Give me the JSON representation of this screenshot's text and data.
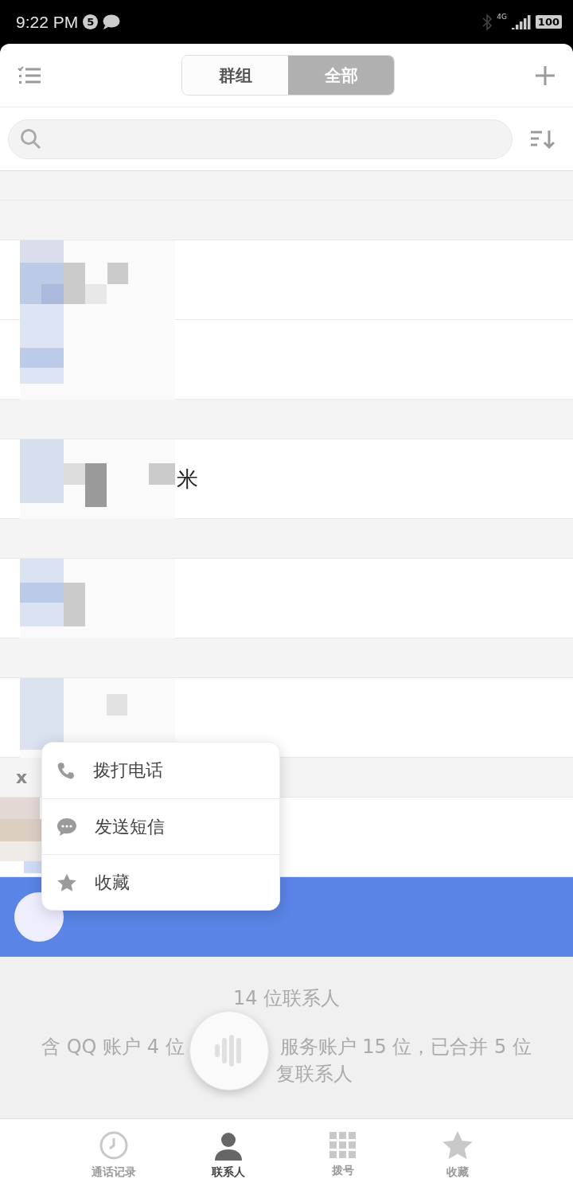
{
  "status_bar": {
    "time": "9:22 PM",
    "notification_count": "5",
    "network": "4G",
    "battery": "100"
  },
  "segments": [
    {
      "label": "群组",
      "selected": false
    },
    {
      "label": "全部",
      "selected": true
    }
  ],
  "list": [
    {
      "kind": "partial_header"
    },
    {
      "kind": "header"
    },
    {
      "kind": "contact"
    },
    {
      "kind": "contact"
    },
    {
      "kind": "header"
    },
    {
      "kind": "contact",
      "name": "米"
    },
    {
      "kind": "header"
    },
    {
      "kind": "contact"
    },
    {
      "kind": "header"
    },
    {
      "kind": "contact"
    },
    {
      "kind": "header",
      "letter": "x"
    },
    {
      "kind": "contact"
    },
    {
      "kind": "promo"
    }
  ],
  "summary": {
    "count": "14 位联系人",
    "detail_start": "含 QQ 账户 4 位",
    "detail_end": "服务账户 15 位，已合并 5 位",
    "detail_line2": "复联系人"
  },
  "context_menu": [
    {
      "kind": "call",
      "label": "拨打电话"
    },
    {
      "kind": "message",
      "label": "发送短信"
    },
    {
      "kind": "favorite",
      "label": "收藏"
    }
  ],
  "bottom_nav": [
    {
      "kind": "clock",
      "label": "通话记录",
      "selected": false
    },
    {
      "kind": "person",
      "label": "联系人",
      "selected": true
    },
    {
      "kind": "dialpad",
      "label": "拨号",
      "selected": false
    },
    {
      "kind": "star",
      "label": "收藏",
      "selected": false
    }
  ]
}
